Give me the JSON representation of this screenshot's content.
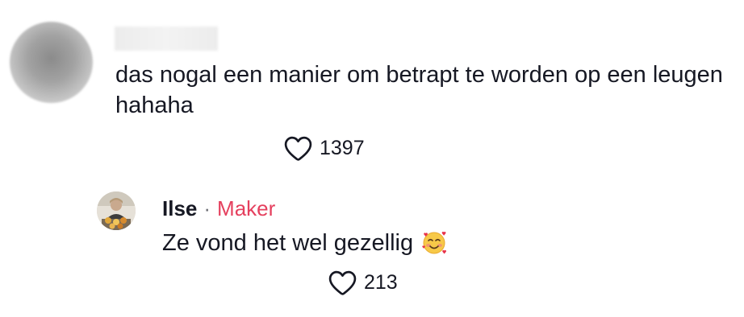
{
  "comment": {
    "avatar_icon": "blurred-avatar",
    "text": "das nogal een manier om betrapt te worden op een leugen hahaha",
    "likes": "1397"
  },
  "reply": {
    "author": "Ilse",
    "separator": "·",
    "badge": "Maker",
    "text": "Ze vond het wel gezellig",
    "emoji": "smiling-face-with-hearts",
    "likes": "213"
  },
  "colors": {
    "text": "#161823",
    "muted": "#6e6f75",
    "creator_badge": "#e5405e",
    "heart_outline": "#161823"
  }
}
